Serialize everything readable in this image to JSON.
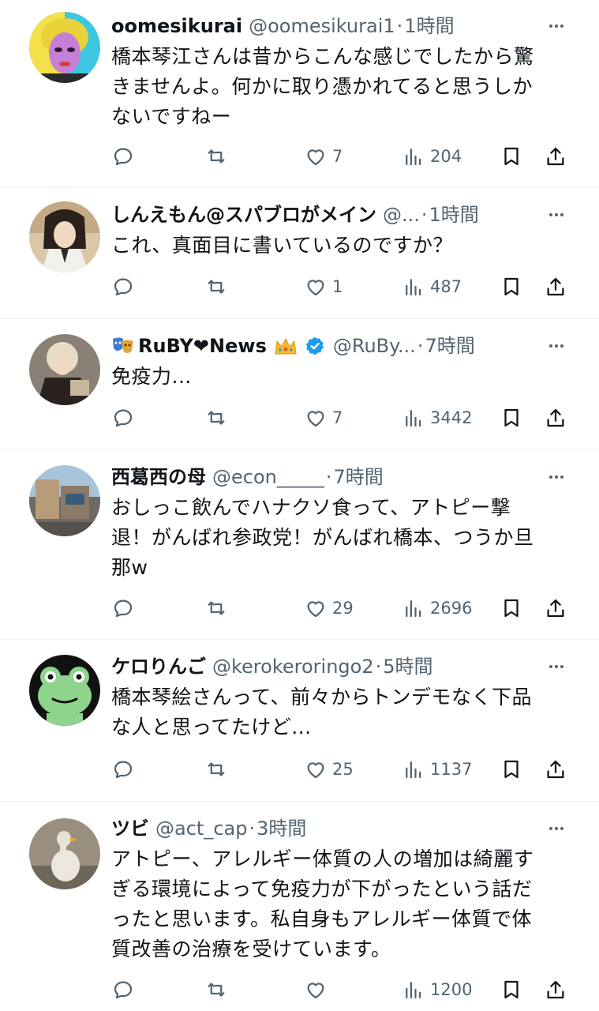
{
  "tweets": [
    {
      "name": "oomesikurai",
      "handle": "@oomesikurai1",
      "time": "1時間",
      "text": [
        "橋本琴江さんは昔からこんな感じでしたから驚",
        "きませんよ。何かに取り憑かれてると思うしか",
        "ないですねー"
      ],
      "likes": "7",
      "views": "204",
      "avatar": "pop-art-portrait"
    },
    {
      "name": "しんえもん@スパブロがメイン",
      "handle": "@...",
      "time": "1時間",
      "text": [
        "これ、真面目に書いているのですか？"
      ],
      "likes": "1",
      "views": "487",
      "avatar": "anime-samurai"
    },
    {
      "name": "RuBY❤News",
      "name_prefix_icon": "theater-masks-icon",
      "name_suffix_icon": "crown-icon",
      "verified": true,
      "handle": "@RuBy...",
      "time": "7時間",
      "text": [
        "免疫力..."
      ],
      "likes": "7",
      "views": "3442",
      "avatar": "blonde-person"
    },
    {
      "name": "西葛西の母",
      "handle": "@econ_____",
      "time": "7時間",
      "text": [
        "おしっこ飲んでハナクソ食って、アトピー撃",
        "退！がんばれ参政党！がんばれ橋本、つうか旦",
        "那w"
      ],
      "likes": "29",
      "views": "2696",
      "avatar": "street-photo"
    },
    {
      "name": "ケロりんご",
      "handle": "@kerokeroringo2",
      "time": "5時間",
      "text": [
        "橋本琴絵さんって、前々からトンデモなく下品",
        "な人と思ってたけど..."
      ],
      "likes": "25",
      "views": "1137",
      "avatar": "green-frog"
    },
    {
      "name": "ツビ",
      "handle": "@act_cap",
      "time": "3時間",
      "text": [
        "アトピー、アレルギー体質の人の増加は綺麗す",
        "ぎる環境によって免疫力が下がったという話だ",
        "ったと思います。私自身もアレルギー体質で体",
        "質改善の治療を受けています。"
      ],
      "likes": "",
      "views": "1200",
      "avatar": "duck-statue"
    }
  ],
  "colors": {
    "text": "#0f1419",
    "secondary": "#536471",
    "divider": "#eff3f4",
    "verified": "#1d9bf0"
  }
}
